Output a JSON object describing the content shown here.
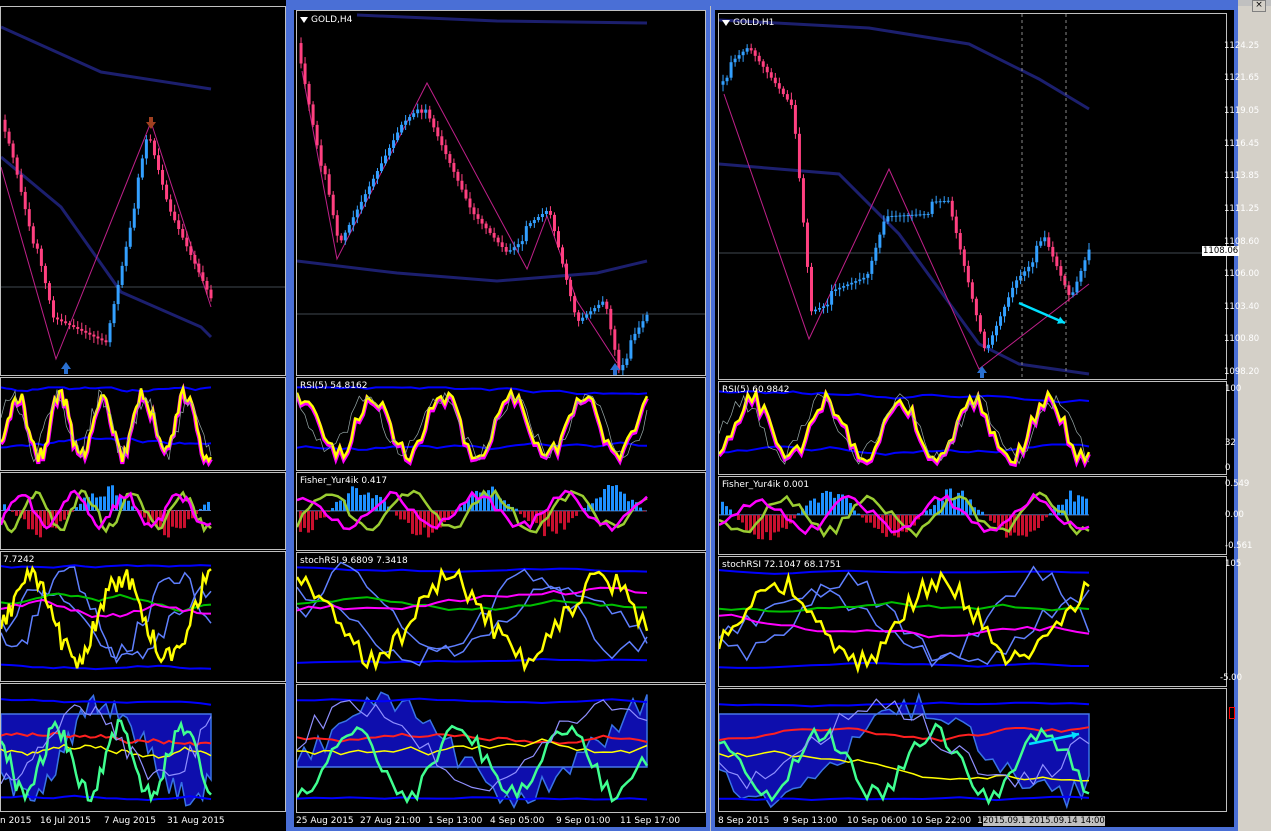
{
  "windows": [
    {
      "id": "left",
      "xaxis": [
        "n 2015",
        "16 Jul 2015",
        "7 Aug 2015",
        "31 Aug 2015"
      ],
      "stoch_label": "7.7242"
    },
    {
      "id": "middle",
      "title": "GOLD,H4",
      "rsi_label": "RSI(5) 54.8162",
      "fisher_label": "Fisher_Yur4ik 0.417",
      "stoch_label": "stochRSI 9.6809 7.3418",
      "xaxis": [
        "25 Aug 2015",
        "27 Aug 21:00",
        "1 Sep 13:00",
        "4 Sep 05:00",
        "9 Sep 01:00",
        "11 Sep 17:00"
      ]
    },
    {
      "id": "right",
      "title": "GOLD,H1",
      "rsi_label": "RSI(5) 60.9842",
      "fisher_label": "Fisher_Yur4ik 0.001",
      "stoch_label": "stochRSI 72.1047 68.1751",
      "price_scale": [
        "1124.25",
        "1121.65",
        "1119.05",
        "1116.45",
        "1113.85",
        "1111.25",
        "1108.60",
        "1106.00",
        "1103.40",
        "1100.80",
        "1098.20"
      ],
      "current_price": "1108.06",
      "rsi_scale": [
        "100",
        "32",
        "0"
      ],
      "fisher_scale": [
        "0.549",
        "0.00",
        "-0.561"
      ],
      "stoch_scale": [
        "105",
        "-5.00"
      ],
      "xaxis": [
        "8 Sep 2015",
        "9 Sep 13:00",
        "10 Sep 06:00",
        "10 Sep 22:00",
        "1"
      ],
      "selected_time": "2015.09.1 2015.09.14 14:00"
    }
  ],
  "colors": {
    "rsi_main": "#ffff00",
    "rsi_shadow": "#ff00ff",
    "bands": "#0000ff",
    "ma_dark": "#1c1f6e",
    "fisher_up": "#1e90ff",
    "fisher_down": "#c8102e",
    "candle_up": "#33a0ff",
    "candle_down": "#ff4080",
    "arrow": "#00e0ff"
  }
}
